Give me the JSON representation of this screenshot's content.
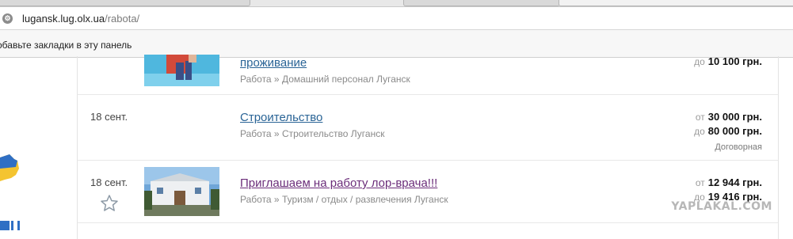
{
  "browser": {
    "site_icon_glyph": "⚙",
    "url_host": "lugansk.lug.olx.ua",
    "url_path": "/rabota/",
    "bookmarks_hint": "обавьте закладки в эту панель"
  },
  "listings": [
    {
      "title": "проживание",
      "category": "Работа » Домашний персонал Луганск",
      "price_prefix": "до",
      "price": "10 100 грн.",
      "thumb_icon": "pool-photo"
    },
    {
      "date": "18 сент.",
      "title": "Строительство",
      "category": "Работа » Строительство Луганск",
      "price_from_prefix": "от",
      "price_from": "30 000 грн.",
      "price_to_prefix": "до",
      "price_to": "80 000 грн.",
      "negotiable": "Договорная"
    },
    {
      "date": "18 сент.",
      "title": "Приглашаем на работу лор-врача!!!",
      "category": "Работа » Туризм / отдых / развлечения Луганск",
      "price_from_prefix": "от",
      "price_from": "12 944 грн.",
      "price_to_prefix": "до",
      "price_to": "19 416 грн.",
      "thumb_icon": "building-photo",
      "favorite_icon": "star-outline-icon"
    }
  ],
  "watermark": "YAPLAKAL.COM",
  "colors": {
    "link": "#2a6496",
    "visited_link": "#6b2d7a",
    "muted": "#8a8a8a"
  }
}
